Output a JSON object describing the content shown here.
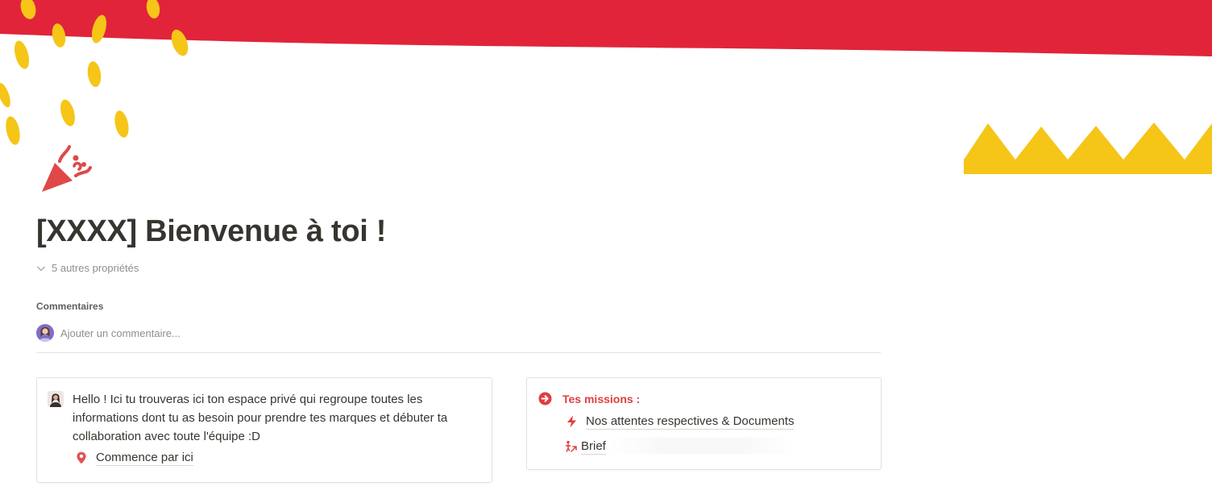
{
  "page": {
    "title": "[XXXX] Bienvenue à toi !",
    "properties_toggle": "5 autres propriétés"
  },
  "comments": {
    "label": "Commentaires",
    "placeholder": "Ajouter un commentaire..."
  },
  "intro_card": {
    "text": "Hello ! Ici tu trouveras ici ton espace privé qui regroupe toutes les informations dont tu as besoin pour prendre tes marques et débuter ta collaboration avec toute l'équipe :D",
    "link": "Commence par ici",
    "link_icon": "map-pin-icon"
  },
  "missions_card": {
    "heading": "Tes missions :",
    "heading_icon": "arrow-circle-right-icon",
    "items": [
      {
        "label": "Nos attentes respectives & Documents",
        "icon": "lightning-bolt-icon"
      },
      {
        "label": "Brief",
        "icon": "person-arrow-icon"
      }
    ]
  },
  "colors": {
    "accent_red": "#e1243a",
    "confetti_yellow": "#f5c518",
    "text": "#37352f",
    "muted": "#8f8e8b",
    "link_red": "#e03e3e"
  },
  "cover_icons": {
    "page_icon": "party-popper-icon"
  }
}
